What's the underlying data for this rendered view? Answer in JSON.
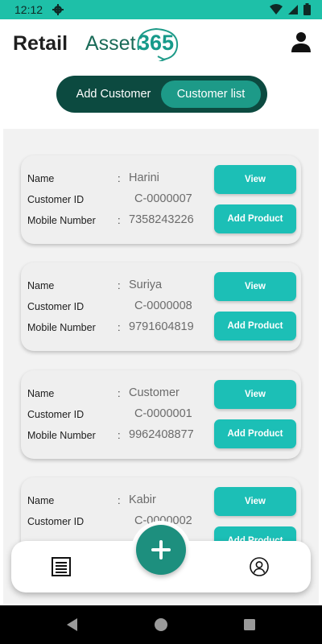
{
  "status_bar": {
    "time": "12:12"
  },
  "header": {
    "logo_part1": "Retail",
    "logo_part2": "Asset",
    "logo_part3": "365"
  },
  "toggle": {
    "add_customer": "Add Customer",
    "customer_list": "Customer list"
  },
  "labels": {
    "name": "Name",
    "customer_id": "Customer ID",
    "mobile": "Mobile Number",
    "colon": ":"
  },
  "buttons": {
    "view": "View",
    "add_product": "Add Product"
  },
  "customers": [
    {
      "name": "Harini",
      "id": "C-0000007",
      "mobile": "7358243226"
    },
    {
      "name": "Suriya",
      "id": "C-0000008",
      "mobile": "9791604819"
    },
    {
      "name": "Customer",
      "id": "C-0000001",
      "mobile": "9962408877"
    },
    {
      "name": "Kabir",
      "id": "C-0000002",
      "mobile": ""
    }
  ],
  "colors": {
    "brand": "#1d9a88",
    "dark_green": "#0c4a40",
    "button": "#1cbfb6",
    "status_bar": "#1ec0a8"
  },
  "icons": {
    "status": [
      "gear-icon",
      "wifi-icon",
      "signal-icon",
      "battery-icon"
    ],
    "header": "user-icon",
    "nav": [
      "list-icon",
      "add-icon",
      "profile-icon"
    ],
    "system": [
      "back-icon",
      "home-icon",
      "recents-icon"
    ]
  }
}
